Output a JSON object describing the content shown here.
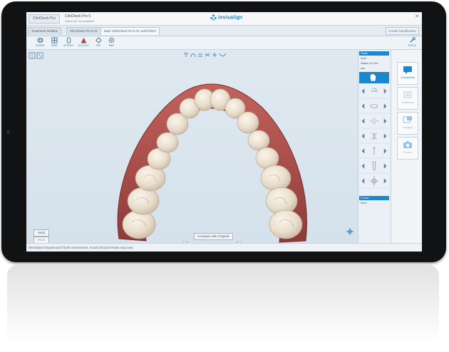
{
  "window": {
    "home_button": "ClinCheck Pro",
    "product_title": "ClinCheck Pro 5",
    "notes_text": "Notes are not available",
    "logo_text": "invisalign"
  },
  "tabs": [
    {
      "label": "Treatment timeline"
    },
    {
      "label": "ClinCheck Pro 5 #1"
    },
    {
      "label": "Mod. ClinCheck Pro 5 #1  11/07/2017"
    }
  ],
  "create_modification": "Create Modification",
  "tools": [
    {
      "label": "SUPER",
      "icon": "superimpose-icon"
    },
    {
      "label": "GRID",
      "icon": "grid-icon"
    },
    {
      "label": "ATTACH",
      "icon": "attachment-icon"
    },
    {
      "label": "OCCLUS",
      "icon": "occlusion-icon"
    },
    {
      "label": "IPR",
      "icon": "ipr-icon"
    },
    {
      "label": "TMN",
      "icon": "tmn-icon"
    }
  ],
  "tools_menu": "TOOLS",
  "left_buttons": {
    "undo": "Undo",
    "redo": "Redo",
    "reset": "Reset"
  },
  "compare_button": "Compare with Original",
  "status_text": "Simulated Gingival and Tooth movements. Actual clinical results may vary.",
  "panel": {
    "top_items": [
      "Tooth",
      "Arch",
      "Attach & Cuts",
      "sss"
    ],
    "bottom_items": [
      "Crown",
      "Root"
    ],
    "selected_top": "Tooth",
    "selected_bottom": "Crown"
  },
  "right_sidebar": [
    {
      "label": "Comments",
      "icon": "comments-icon",
      "enabled": true
    },
    {
      "label": "Treatment",
      "icon": "treatment-icon",
      "enabled": false
    },
    {
      "label": "Staging",
      "icon": "staging-icon",
      "enabled": false
    },
    {
      "label": "Photos",
      "icon": "camera-icon",
      "enabled": false
    }
  ],
  "colors": {
    "accent": "#1b87cf",
    "gum": "#a84a48",
    "tooth": "#efe4d4",
    "background": "#dbe6ef"
  }
}
